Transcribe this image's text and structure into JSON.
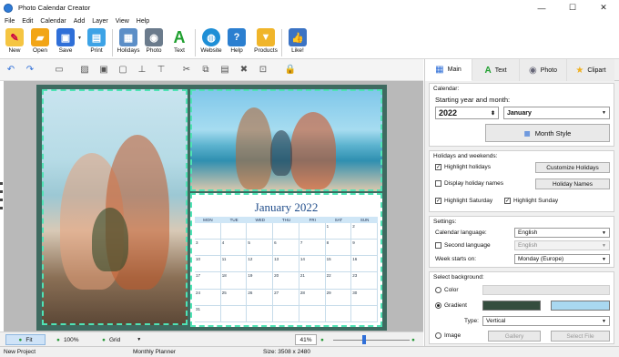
{
  "window": {
    "title": "Photo Calendar Creator",
    "minimize": "—",
    "maximize": "☐",
    "close": "✕"
  },
  "menu": [
    "File",
    "Edit",
    "Calendar",
    "Add",
    "Layer",
    "View",
    "Help"
  ],
  "toolbar": {
    "new": "New",
    "open": "Open",
    "save": "Save",
    "print": "Print",
    "holidays": "Holidays",
    "photo": "Photo",
    "text": "Text",
    "website": "Website",
    "help": "Help",
    "products": "Products",
    "like": "Like!"
  },
  "calendar_page": {
    "title": "January 2022",
    "weekdays": [
      "MON",
      "TUE",
      "WED",
      "THU",
      "FRI",
      "SAT",
      "SUN"
    ],
    "days": [
      "",
      "",
      "",
      "",
      "",
      "1",
      "2",
      "3",
      "4",
      "5",
      "6",
      "7",
      "8",
      "9",
      "10",
      "11",
      "12",
      "13",
      "14",
      "15",
      "16",
      "17",
      "18",
      "19",
      "20",
      "21",
      "22",
      "23",
      "24",
      "25",
      "26",
      "27",
      "28",
      "29",
      "30",
      "31",
      "",
      "",
      "",
      "",
      "",
      "",
      ""
    ]
  },
  "statusbar": {
    "fit": "Fit",
    "zoom100": "100%",
    "grid": "Grid",
    "zoom_value": "41%",
    "zoom_level_fraction": 0.4
  },
  "bottombar": {
    "project": "New Project",
    "template": "Monthly Planner",
    "size": "Size: 3508 x 2480"
  },
  "panel": {
    "tabs": [
      "Main",
      "Text",
      "Photo",
      "Clipart"
    ],
    "calendar_section": "Calendar:",
    "start_label": "Starting year and month:",
    "year": "2022",
    "month": "January",
    "month_style": "Month Style",
    "holidays_section": "Holidays and weekends:",
    "highlight_holidays": "Highlight holidays",
    "display_holiday_names": "Display holiday names",
    "customize_holidays": "Customize Holidays",
    "holiday_names": "Holiday Names",
    "highlight_saturday": "Highlight Saturday",
    "highlight_sunday": "Highlight Sunday",
    "settings_section": "Settings:",
    "calendar_language_label": "Calendar language:",
    "calendar_language": "English",
    "second_language_label": "Second language",
    "second_language": "English",
    "week_starts_label": "Week starts on:",
    "week_starts": "Monday (Europe)",
    "background_section": "Select background:",
    "color": "Color",
    "gradient": "Gradient",
    "type_label": "Type:",
    "type": "Vertical",
    "image": "Image",
    "gallery": "Gallery",
    "select_file": "Select File",
    "gradient_color1": "#344d3e",
    "gradient_color2": "#a9d8f0"
  }
}
